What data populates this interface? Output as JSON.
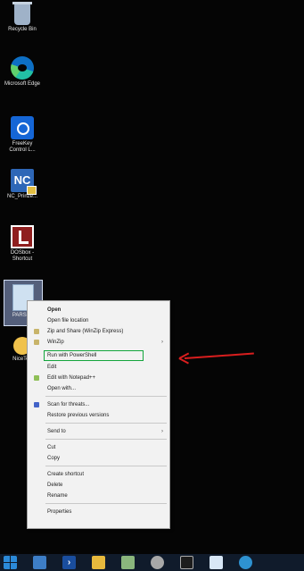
{
  "desktop": {
    "icons": [
      {
        "name": "recycle-bin",
        "label": "Recycle Bin"
      },
      {
        "name": "microsoft-edge",
        "label": "Microsoft Edge"
      },
      {
        "name": "freekey-control",
        "label": "FreeKey Control L..."
      },
      {
        "name": "nc-shortcut",
        "label": "NC_Prinze..."
      },
      {
        "name": "dosbox-shortcut",
        "label": "DOSbox - Shortcut"
      },
      {
        "name": "selected-file",
        "label": "PARSER"
      },
      {
        "name": "yellow-app",
        "label": "NiceTo.."
      }
    ]
  },
  "context_menu": {
    "items": [
      {
        "label": "Open",
        "icon": null,
        "submenu": false
      },
      {
        "label": "Open file location",
        "icon": null,
        "submenu": false
      },
      {
        "label": "Zip and Share (WinZip Express)",
        "icon": "winzip-icon",
        "submenu": false
      },
      {
        "label": "WinZip",
        "icon": "winzip-icon",
        "submenu": true
      },
      {
        "label": "Run with PowerShell",
        "icon": null,
        "submenu": false
      },
      {
        "label": "Edit",
        "icon": null,
        "submenu": false
      },
      {
        "label": "Edit with Notepad++",
        "icon": "notepadpp-icon",
        "submenu": false
      },
      {
        "label": "Open with...",
        "icon": null,
        "submenu": false
      },
      {
        "label": "Scan for threats...",
        "icon": "shield-icon",
        "submenu": false
      },
      {
        "label": "Restore previous versions",
        "icon": null,
        "submenu": false
      },
      {
        "label": "Send to",
        "icon": null,
        "submenu": true
      },
      {
        "label": "Cut",
        "icon": null,
        "submenu": false
      },
      {
        "label": "Copy",
        "icon": null,
        "submenu": false
      },
      {
        "label": "Create shortcut",
        "icon": null,
        "submenu": false
      },
      {
        "label": "Delete",
        "icon": null,
        "submenu": false
      },
      {
        "label": "Rename",
        "icon": null,
        "submenu": false
      },
      {
        "label": "Properties",
        "icon": null,
        "submenu": false
      }
    ],
    "submenu_glyph": "›"
  },
  "annotation": {
    "color": "#d91e1e",
    "highlight_color": "#13a53c"
  },
  "taskbar": {
    "items": [
      "start-button",
      "file-explorer",
      "powershell",
      "folder",
      "server-manager",
      "tools",
      "command-prompt",
      "notepad",
      "edge"
    ],
    "powershell_glyph": "›"
  }
}
